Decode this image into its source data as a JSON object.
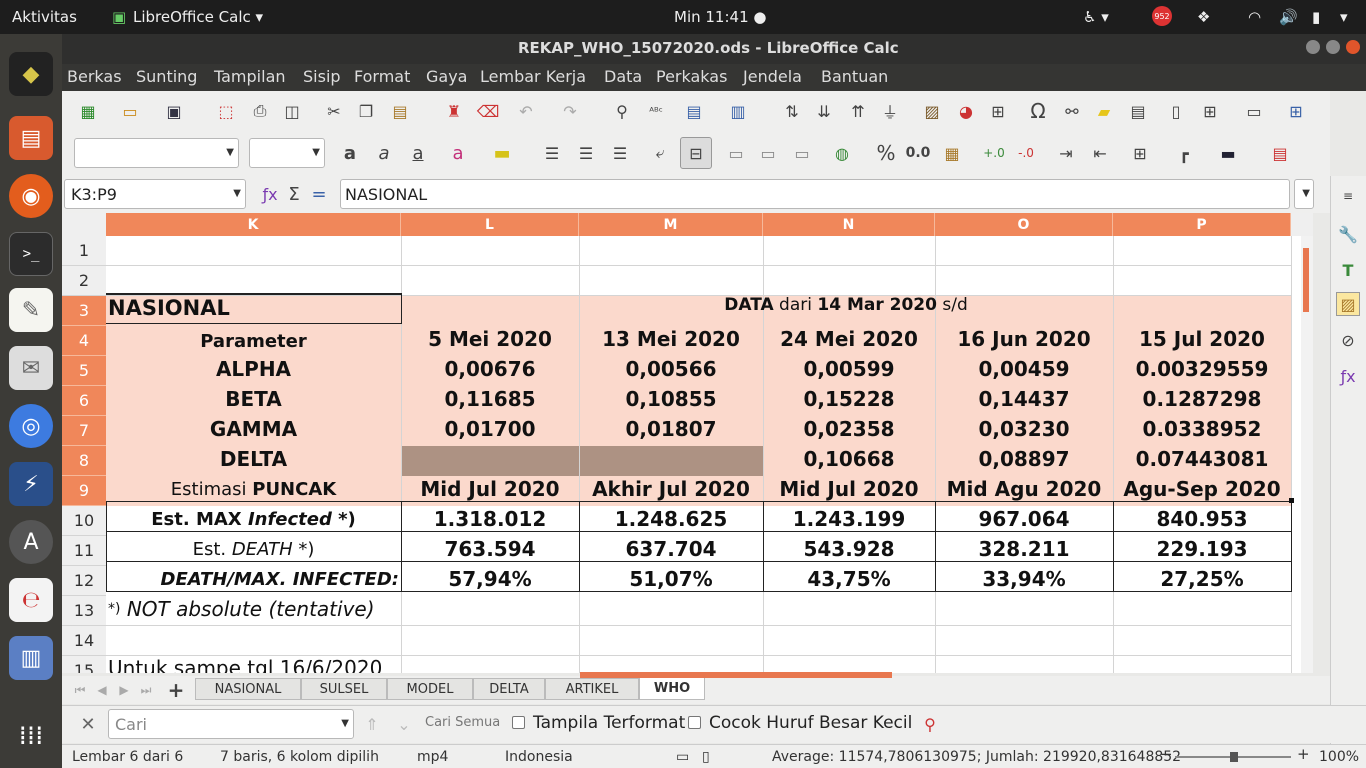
{
  "system": {
    "activities": "Aktivitas",
    "app_name": "LibreOffice Calc",
    "clock": "Min 11:41 ●",
    "notif_count": "952"
  },
  "window": {
    "title": "REKAP_WHO_15072020.ods - LibreOffice Calc"
  },
  "menu": [
    "Berkas",
    "Sunting",
    "Tampilan",
    "Sisip",
    "Format",
    "Gaya",
    "Lembar Kerja",
    "Data",
    "Perkakas",
    "Jendela",
    "Bantuan"
  ],
  "formula": {
    "name_box": "K3:P9",
    "content": "NASIONAL",
    "sigma": "Σ",
    "equals": "="
  },
  "columns": [
    "K",
    "L",
    "M",
    "N",
    "O",
    "P"
  ],
  "rows": [
    "1",
    "2",
    "3",
    "4",
    "5",
    "6",
    "7",
    "8",
    "9",
    "10",
    "11",
    "12",
    "13",
    "14",
    "15"
  ],
  "sheet": {
    "title": "NASIONAL",
    "data_range": {
      "w1": "DATA",
      "w2": " dari ",
      "w3": "14 Mar 2020",
      "w4": " s/d"
    },
    "param_header": "Parameter",
    "dates": [
      "5 Mei 2020",
      "13 Mei 2020",
      "24 Mei 2020",
      "16 Jun 2020",
      "15 Jul 2020"
    ],
    "alpha": {
      "label": "ALPHA",
      "values": [
        "0,00676",
        "0,00566",
        "0,00599",
        "0,00459",
        "0.00329559"
      ]
    },
    "beta": {
      "label": "BETA",
      "values": [
        "0,11685",
        "0,10855",
        "0,15228",
        "0,14437",
        "0.1287298"
      ]
    },
    "gamma": {
      "label": "GAMMA",
      "values": [
        "0,01700",
        "0,01807",
        "0,02358",
        "0,03230",
        "0.0338952"
      ]
    },
    "delta": {
      "label": "DELTA",
      "values": [
        "",
        "",
        "0,10668",
        "0,08897",
        "0.07443081"
      ]
    },
    "peak": {
      "label_a": "Estimasi ",
      "label_b": "PUNCAK",
      "values": [
        "Mid Jul 2020",
        "Akhir Jul 2020",
        "Mid Jul 2020",
        "Mid  Agu 2020",
        "Agu-Sep 2020"
      ]
    },
    "max_infected": {
      "label_a": "Est. MAX ",
      "label_b": "Infected",
      "label_c": " *)",
      "values": [
        "1.318.012",
        "1.248.625",
        "1.243.199",
        "967.064",
        "840.953"
      ]
    },
    "death": {
      "label_a": "Est. ",
      "label_b": "DEATH",
      "label_c": " *)",
      "values": [
        "763.594",
        "637.704",
        "543.928",
        "328.211",
        "229.193"
      ]
    },
    "ratio": {
      "label": "DEATH/MAX. INFECTED:",
      "values": [
        "57,94%",
        "51,07%",
        "43,75%",
        "33,94%",
        "27,25%"
      ]
    },
    "note": {
      "mark": "*)",
      "text": " NOT absolute (tentative)"
    },
    "row15": "Untuk sampe tgl 16/6/2020"
  },
  "tabs": [
    "NASIONAL",
    "SULSEL",
    "MODEL",
    "DELTA",
    "ARTIKEL",
    "WHO"
  ],
  "active_tab": "WHO",
  "find": {
    "placeholder": "Cari",
    "find_all": "Cari Semua",
    "formatted": "Tampila Terformat",
    "match_case": "Cocok Huruf Besar Kecil"
  },
  "status": {
    "sheet": "Lembar 6 dari 6",
    "selection": "7 baris, 6 kolom dipilih",
    "page_style": "mp4",
    "language": "Indonesia",
    "sum": "Average: 11574,7806130975; Jumlah: 219920,831648852",
    "zoom": "100%"
  },
  "colors": {
    "header_accent": "#f0875a",
    "pink_fill": "#fbd9cc",
    "delta_gray": "#ad9283"
  }
}
